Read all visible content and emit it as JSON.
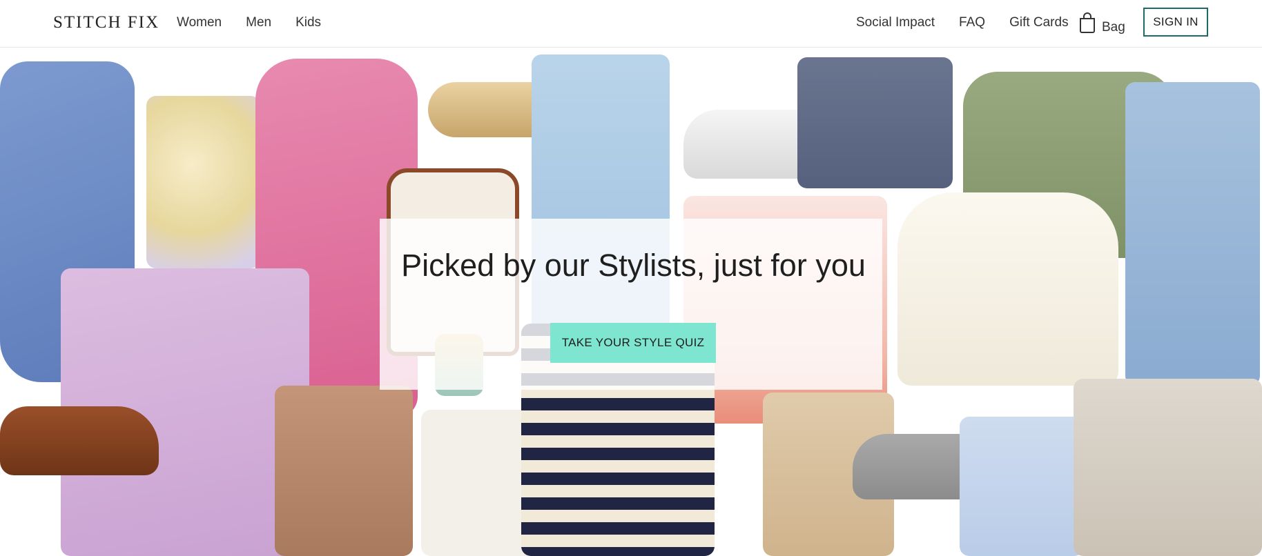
{
  "brand": {
    "logo": "STITCH FIX"
  },
  "nav": {
    "left": [
      "Women",
      "Men",
      "Kids"
    ],
    "right": [
      "Social Impact",
      "FAQ",
      "Gift Cards"
    ],
    "bag_label": "Bag",
    "signin_label": "SIGN IN"
  },
  "hero": {
    "headline": "Picked by our Stylists, just for you",
    "cta_label": "TAKE YOUR STYLE QUIZ"
  },
  "colors": {
    "accent": "#7ee5d1",
    "signin_border": "#1c6a6a"
  },
  "icons": {
    "bag": "shopping-bag-icon"
  }
}
